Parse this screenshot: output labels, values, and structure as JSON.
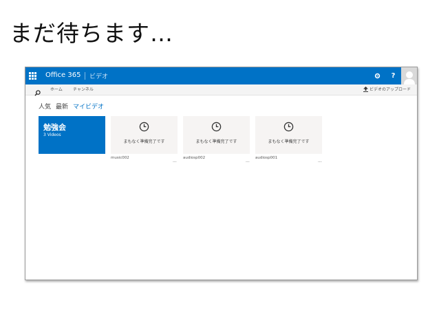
{
  "slide": {
    "title": "まだ待ちます…"
  },
  "app": {
    "name": "Office 365",
    "section": "ビデオ",
    "accent": "#0072c6",
    "settings_label": "⚙",
    "help_label": "?"
  },
  "nav": {
    "home": "ホーム",
    "channels": "チャンネル",
    "upload": "ビデオのアップロード"
  },
  "tabs": [
    {
      "label": "人気",
      "active": false
    },
    {
      "label": "最新",
      "active": false
    },
    {
      "label": "マイビデオ",
      "active": true
    }
  ],
  "channel_tile": {
    "title": "勉強会",
    "subtitle": "3 Videos"
  },
  "videos": [
    {
      "status": "まもなく準備完了です",
      "name": "music002",
      "more": "..."
    },
    {
      "status": "まもなく準備完了です",
      "name": "audiosp002",
      "more": "..."
    },
    {
      "status": "まもなく準備完了です",
      "name": "audiosp001",
      "more": "..."
    }
  ]
}
